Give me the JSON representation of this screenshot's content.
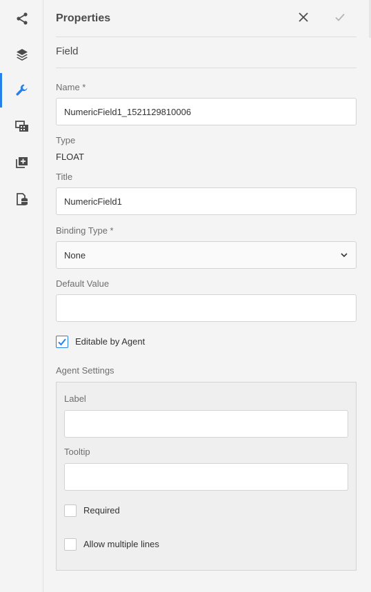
{
  "rail": {
    "items": [
      {
        "icon": "share-icon"
      },
      {
        "icon": "layers-icon"
      },
      {
        "icon": "wrench-icon",
        "active": true
      },
      {
        "icon": "media-icon"
      },
      {
        "icon": "add-copy-icon"
      },
      {
        "icon": "data-source-icon"
      }
    ]
  },
  "header": {
    "title": "Properties",
    "close_icon": "close-icon",
    "confirm_icon": "checkmark-icon"
  },
  "section": {
    "label": "Field"
  },
  "form": {
    "name": {
      "label": "Name *",
      "value": "NumericField1_1521129810006"
    },
    "type": {
      "label": "Type",
      "value": "FLOAT"
    },
    "title": {
      "label": "Title",
      "value": "NumericField1"
    },
    "binding_type": {
      "label": "Binding Type *",
      "value": "None"
    },
    "default_value": {
      "label": "Default Value",
      "value": ""
    },
    "editable_by_agent": {
      "label": "Editable by Agent",
      "checked": true
    }
  },
  "agent_settings": {
    "heading": "Agent Settings",
    "label": {
      "label": "Label",
      "value": ""
    },
    "tooltip": {
      "label": "Tooltip",
      "value": ""
    },
    "required": {
      "label": "Required",
      "checked": false
    },
    "allow_multiple_lines": {
      "label": "Allow multiple lines",
      "checked": false
    }
  },
  "colors": {
    "accent": "#2680eb",
    "icon": "#4b4b4b",
    "icon_disabled": "#b3b3b3"
  }
}
